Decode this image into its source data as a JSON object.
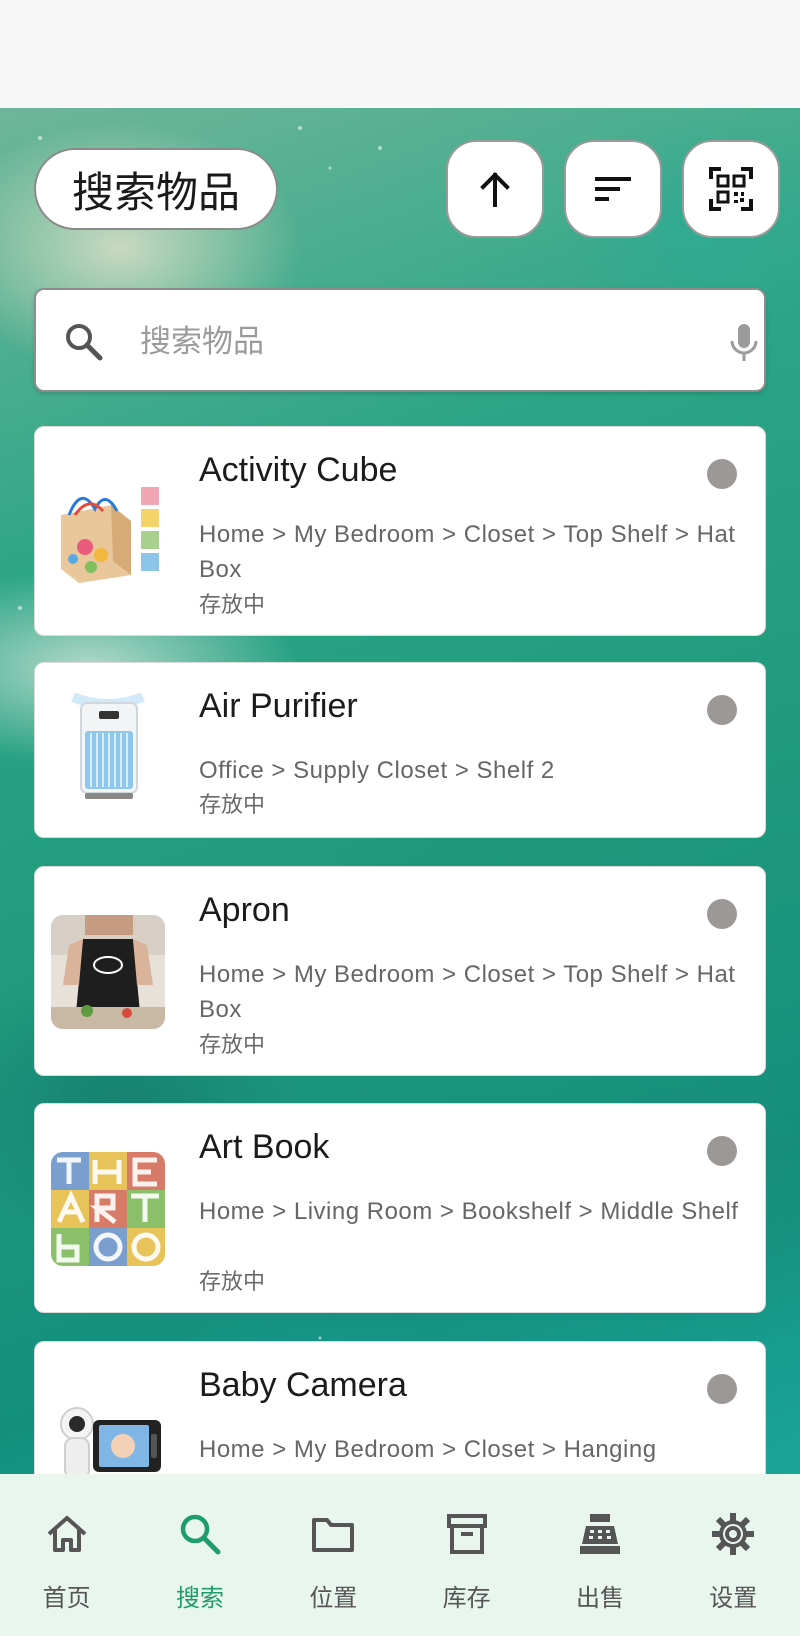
{
  "header": {
    "title": "搜索物品",
    "buttons": [
      {
        "icon": "arrow-up-icon"
      },
      {
        "icon": "sort-icon"
      },
      {
        "icon": "qr-scan-icon"
      }
    ]
  },
  "search": {
    "placeholder": "搜索物品",
    "value": ""
  },
  "items": [
    {
      "name": "Activity Cube",
      "path": "Home > My Bedroom > Closet > Top Shelf > Hat Box",
      "status": "存放中",
      "icon": "activity-cube-thumbnail"
    },
    {
      "name": "Air Purifier",
      "path": "Office > Supply Closet > Shelf 2",
      "status": "存放中",
      "icon": "air-purifier-thumbnail"
    },
    {
      "name": "Apron",
      "path": "Home > My Bedroom > Closet > Top Shelf > Hat Box",
      "status": "存放中",
      "icon": "apron-thumbnail"
    },
    {
      "name": "Art Book",
      "path": "Home > Living Room > Bookshelf > Middle Shelf",
      "status": "存放中",
      "icon": "art-book-thumbnail"
    },
    {
      "name": "Baby Camera",
      "path": "Home > My Bedroom > Closet > Hanging",
      "status": "",
      "icon": "baby-camera-thumbnail"
    }
  ],
  "nav": [
    {
      "label": "首页",
      "icon": "home-icon",
      "active": false
    },
    {
      "label": "搜索",
      "icon": "search-icon",
      "active": true
    },
    {
      "label": "位置",
      "icon": "folder-icon",
      "active": false
    },
    {
      "label": "库存",
      "icon": "archive-icon",
      "active": false
    },
    {
      "label": "出售",
      "icon": "cash-register-icon",
      "active": false
    },
    {
      "label": "设置",
      "icon": "gear-icon",
      "active": false
    }
  ],
  "colors": {
    "accent": "#1d9c6e",
    "nav_background": "#e9f6ee",
    "status_dot": "#9c9895"
  }
}
